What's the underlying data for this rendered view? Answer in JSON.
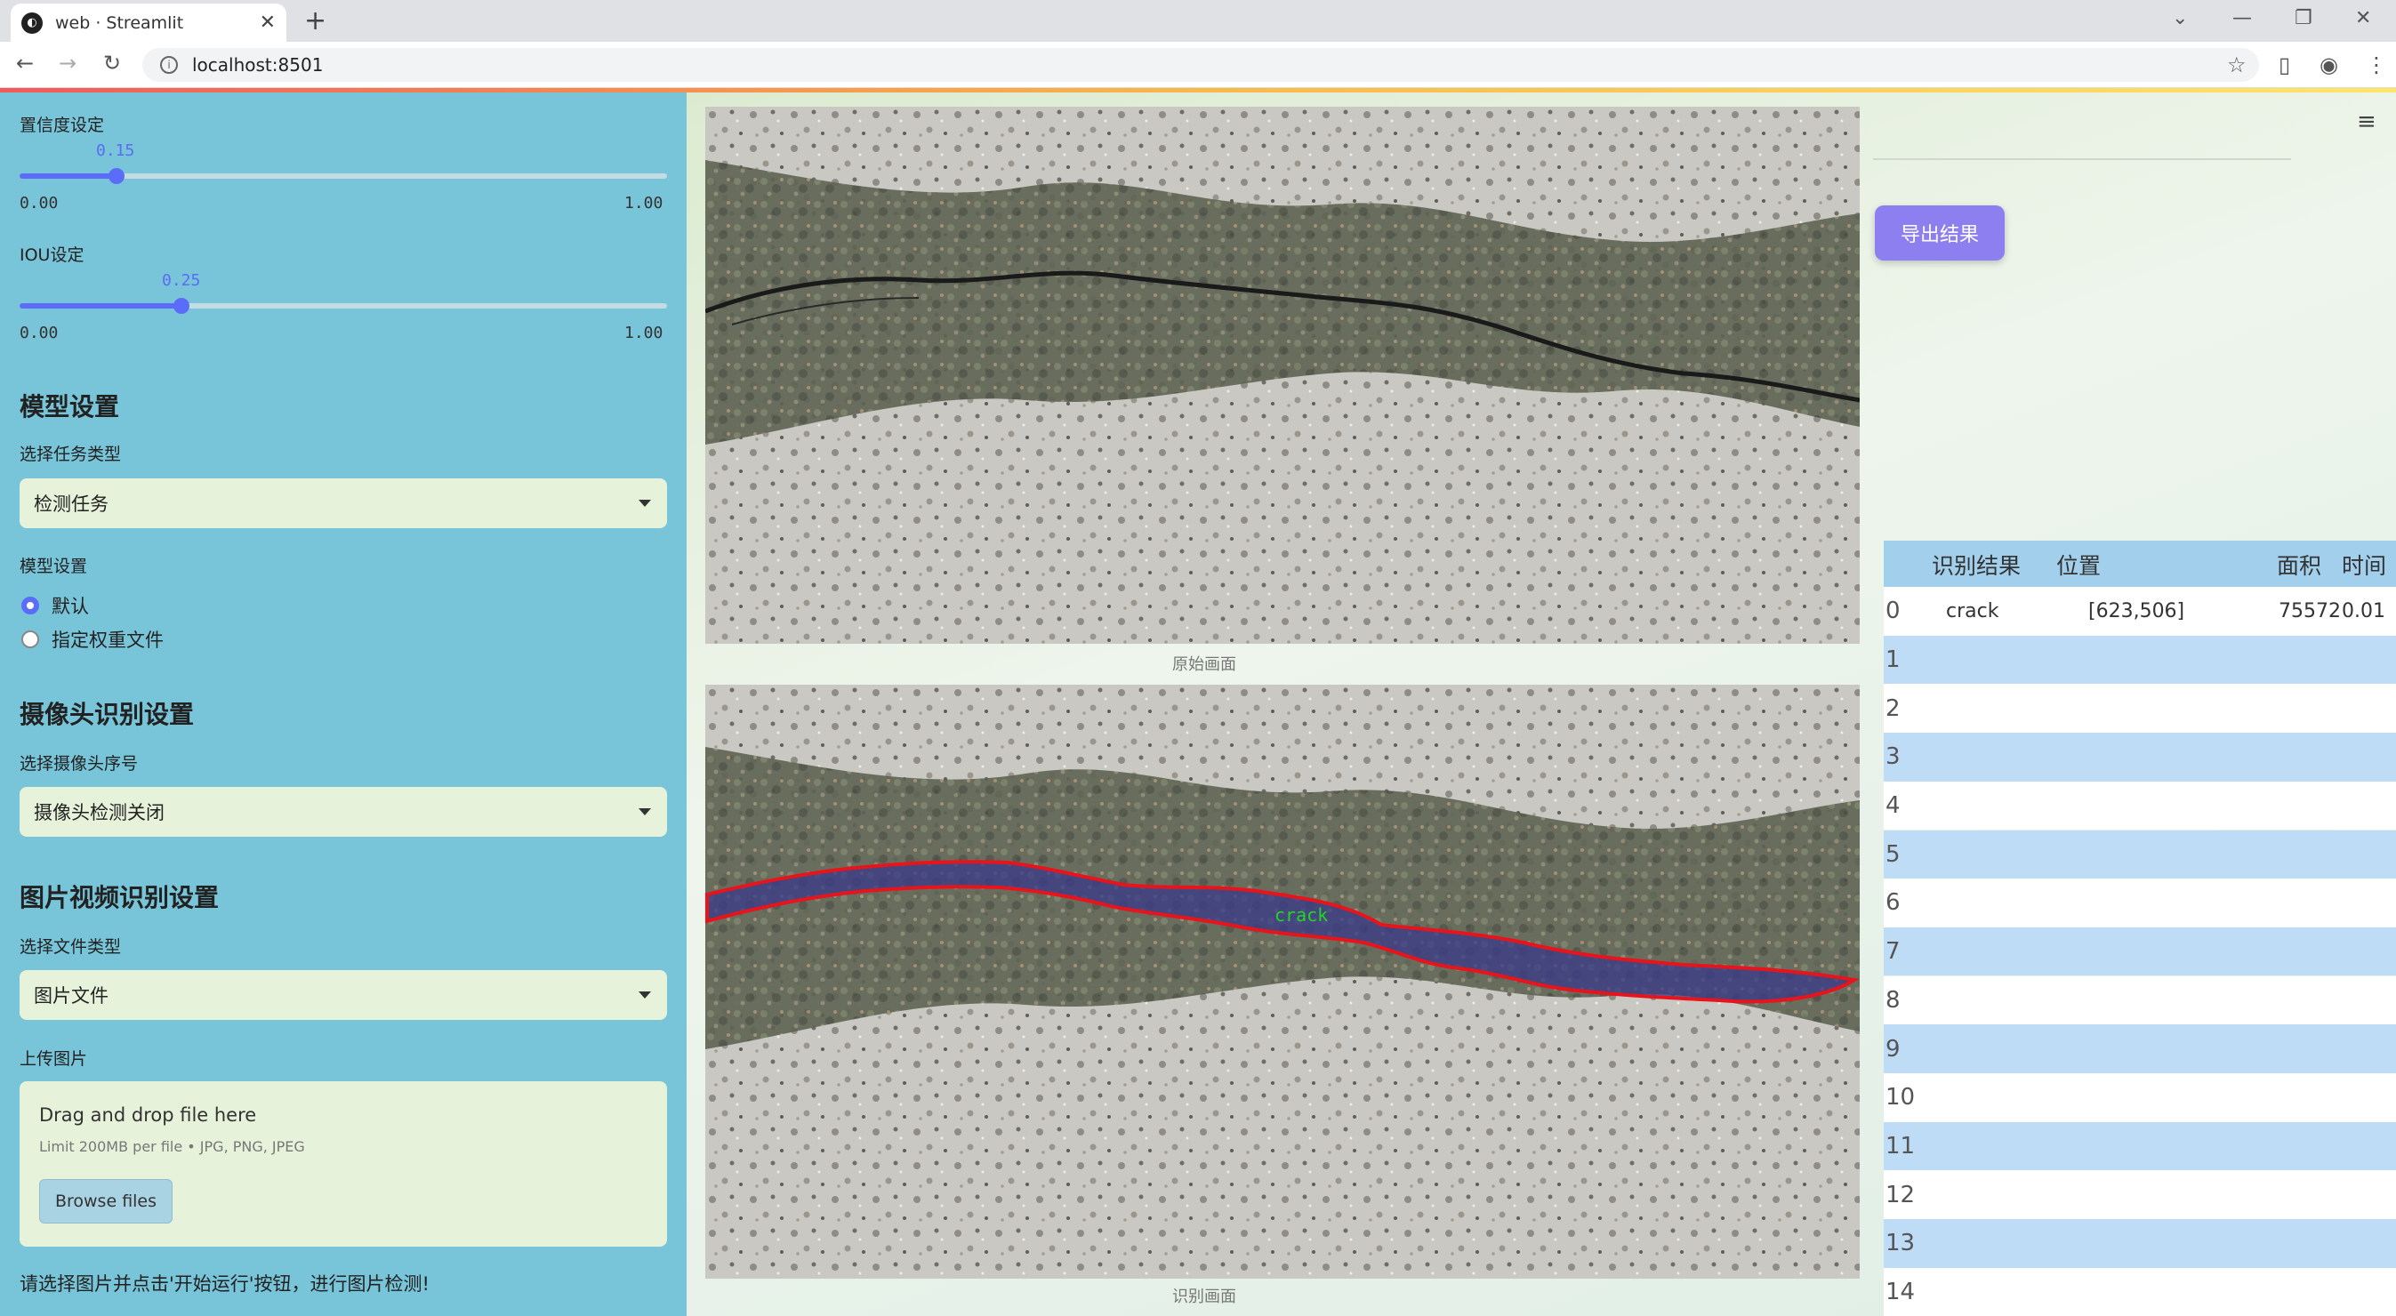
{
  "browser": {
    "tab_title": "web · Streamlit",
    "url": "localhost:8501"
  },
  "sidebar": {
    "conf": {
      "label": "置信度设定",
      "value": "0.15",
      "min": "0.00",
      "max": "1.00",
      "fraction": 0.15
    },
    "iou": {
      "label": "IOU设定",
      "value": "0.25",
      "min": "0.00",
      "max": "1.00",
      "fraction": 0.25
    },
    "model_header": "模型设置",
    "task_label": "选择任务类型",
    "task_value": "检测任务",
    "model_label": "模型设置",
    "radio_default": "默认",
    "radio_custom": "指定权重文件",
    "camera_header": "摄像头识别设置",
    "camera_label": "选择摄像头序号",
    "camera_value": "摄像头检测关闭",
    "file_header": "图片视频识别设置",
    "file_type_label": "选择文件类型",
    "file_type_value": "图片文件",
    "upload_label": "上传图片",
    "upload_drag": "Drag and drop file here",
    "upload_limit": "Limit 200MB per file • JPG, PNG, JPEG",
    "upload_button": "Browse files",
    "hint": "请选择图片并点击'开始运行'按钮，进行图片检测!"
  },
  "main": {
    "original_caption": "原始画面",
    "result_caption": "识别画面",
    "detection_label": "crack",
    "export_button": "导出结果"
  },
  "table": {
    "headers": [
      "识别结果",
      "位置",
      "面积",
      "时间"
    ],
    "rows": [
      {
        "idx": "0",
        "result": "crack",
        "position": "[623,506]",
        "area": "75572",
        "time": "0.01"
      },
      {
        "idx": "1",
        "result": "",
        "position": "",
        "area": "",
        "time": ""
      },
      {
        "idx": "2",
        "result": "",
        "position": "",
        "area": "",
        "time": ""
      },
      {
        "idx": "3",
        "result": "",
        "position": "",
        "area": "",
        "time": ""
      },
      {
        "idx": "4",
        "result": "",
        "position": "",
        "area": "",
        "time": ""
      },
      {
        "idx": "5",
        "result": "",
        "position": "",
        "area": "",
        "time": ""
      },
      {
        "idx": "6",
        "result": "",
        "position": "",
        "area": "",
        "time": ""
      },
      {
        "idx": "7",
        "result": "",
        "position": "",
        "area": "",
        "time": ""
      },
      {
        "idx": "8",
        "result": "",
        "position": "",
        "area": "",
        "time": ""
      },
      {
        "idx": "9",
        "result": "",
        "position": "",
        "area": "",
        "time": ""
      },
      {
        "idx": "10",
        "result": "",
        "position": "",
        "area": "",
        "time": ""
      },
      {
        "idx": "11",
        "result": "",
        "position": "",
        "area": "",
        "time": ""
      },
      {
        "idx": "12",
        "result": "",
        "position": "",
        "area": "",
        "time": ""
      },
      {
        "idx": "13",
        "result": "",
        "position": "",
        "area": "",
        "time": ""
      },
      {
        "idx": "14",
        "result": "",
        "position": "",
        "area": "",
        "time": ""
      }
    ]
  },
  "colors": {
    "accent": "#5a6cf8",
    "sidebar": "#78c4d8",
    "export": "#8d7ff0",
    "mask_outline": "#e8141c",
    "mask_fill": "#3a3a8a",
    "label_green": "#22d622"
  },
  "icons": [
    "back-icon",
    "forward-icon",
    "reload-icon",
    "info-icon",
    "star-icon",
    "sidepanel-icon",
    "profile-icon",
    "menu-icon",
    "hamburger-icon"
  ]
}
